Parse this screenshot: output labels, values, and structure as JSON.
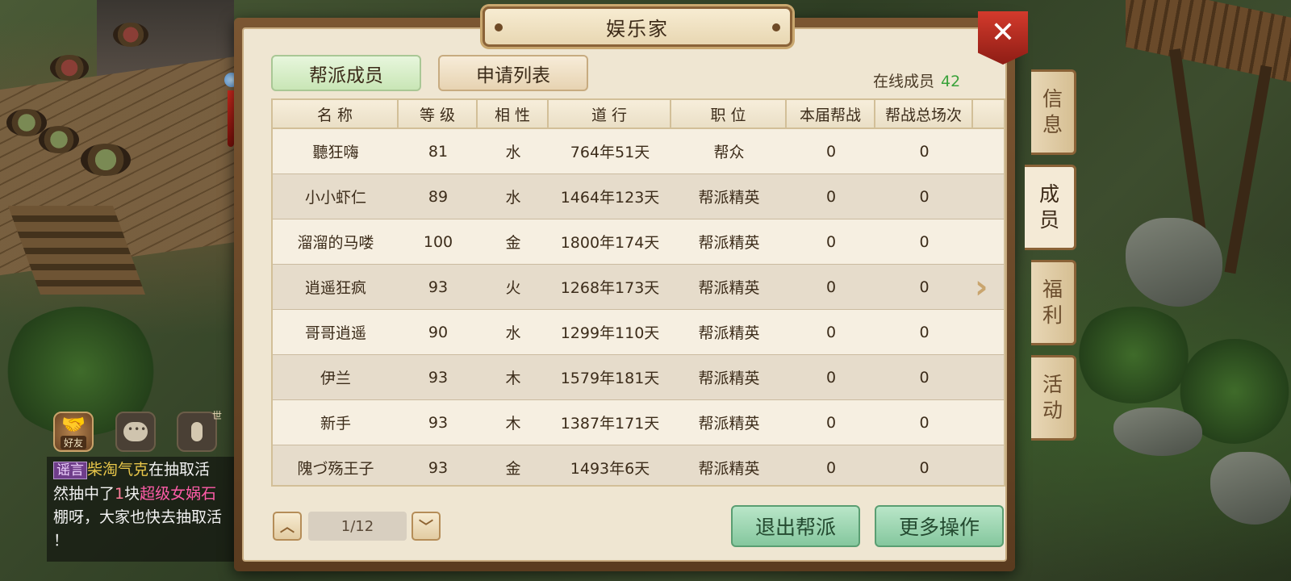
{
  "window": {
    "title": "娱乐家"
  },
  "tabs": [
    {
      "label": "帮派成员",
      "active": true
    },
    {
      "label": "申请列表",
      "active": false
    }
  ],
  "online": {
    "label": "在线成员",
    "count": "42"
  },
  "table": {
    "headers": [
      "名 称",
      "等 级",
      "相 性",
      "道 行",
      "职 位",
      "本届帮战",
      "帮战总场次",
      ""
    ],
    "rows": [
      {
        "name": "聽狂嗨",
        "level": "81",
        "element": "水",
        "dao": "764年51天",
        "position": "帮众",
        "war_current": "0",
        "war_total": "0"
      },
      {
        "name": "小小虾仁",
        "level": "89",
        "element": "水",
        "dao": "1464年123天",
        "position": "帮派精英",
        "war_current": "0",
        "war_total": "0"
      },
      {
        "name": "溜溜的马喽",
        "level": "100",
        "element": "金",
        "dao": "1800年174天",
        "position": "帮派精英",
        "war_current": "0",
        "war_total": "0"
      },
      {
        "name": "逍遥狂疯",
        "level": "93",
        "element": "火",
        "dao": "1268年173天",
        "position": "帮派精英",
        "war_current": "0",
        "war_total": "0"
      },
      {
        "name": "哥哥逍遥",
        "level": "90",
        "element": "水",
        "dao": "1299年110天",
        "position": "帮派精英",
        "war_current": "0",
        "war_total": "0"
      },
      {
        "name": "伊兰",
        "level": "93",
        "element": "木",
        "dao": "1579年181天",
        "position": "帮派精英",
        "war_current": "0",
        "war_total": "0"
      },
      {
        "name": "新手",
        "level": "93",
        "element": "木",
        "dao": "1387年171天",
        "position": "帮派精英",
        "war_current": "0",
        "war_total": "0"
      },
      {
        "name": "隗づ殇王子",
        "level": "93",
        "element": "金",
        "dao": "1493年6天",
        "position": "帮派精英",
        "war_current": "0",
        "war_total": "0"
      }
    ]
  },
  "pager": {
    "display": "1/12"
  },
  "actions": {
    "quit": "退出帮派",
    "more": "更多操作"
  },
  "side_tabs": [
    {
      "label_1": "信",
      "label_2": "息",
      "active": false
    },
    {
      "label_1": "成",
      "label_2": "员",
      "active": true
    },
    {
      "label_1": "福",
      "label_2": "利",
      "active": false
    },
    {
      "label_1": "活",
      "label_2": "动",
      "active": false
    }
  ],
  "hud": {
    "friend_label": "好友",
    "mic_tag": "世"
  },
  "chat": {
    "channel": "谣言",
    "sender": "柴淘气克",
    "text1": "在抽取活",
    "text2": "然抽中了",
    "number": "1",
    "unit": "块",
    "item": "超级女娲石",
    "text3": "棚呀，大家也快去抽取活",
    "text4": "！"
  },
  "colors": {
    "online_count": "#3aa23a",
    "active_tab": "#c9e6b6",
    "action_button": "#85c79e",
    "close_button": "#d33a2c"
  }
}
